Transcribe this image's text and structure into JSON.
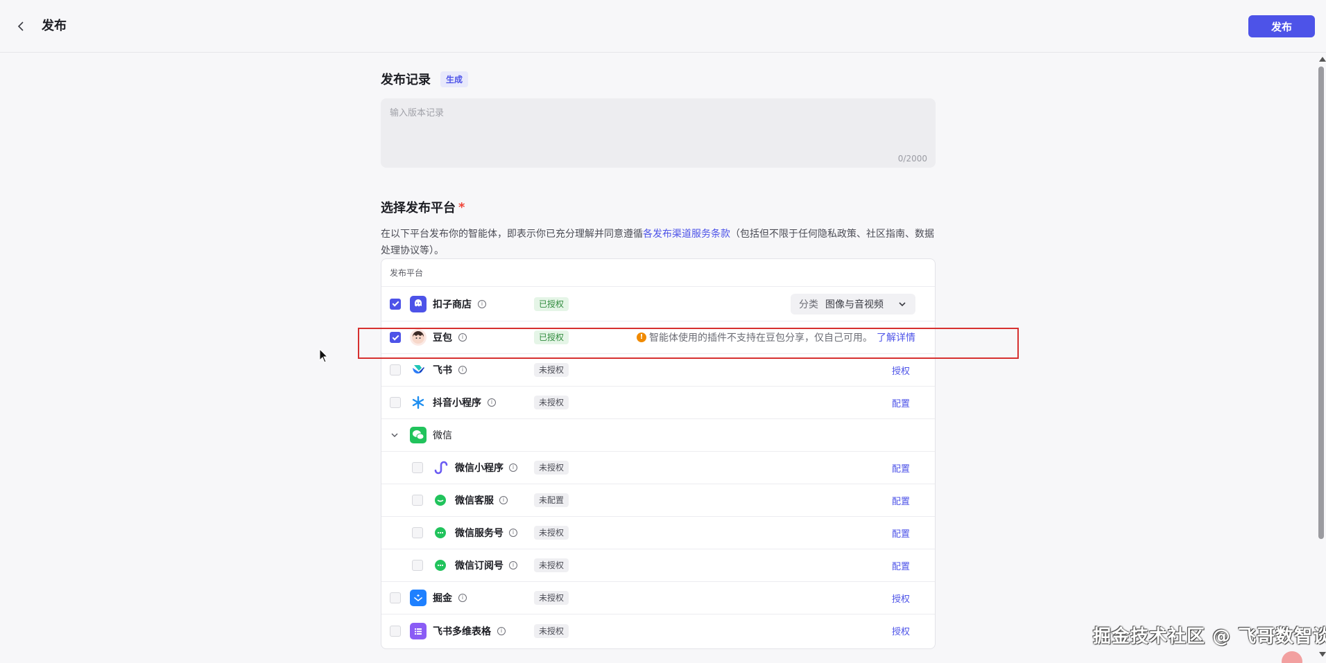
{
  "header": {
    "title": "发布",
    "publish_label": "发布"
  },
  "record": {
    "title": "发布记录",
    "badge": "生成",
    "placeholder": "输入版本记录",
    "counter": "0/2000"
  },
  "platform_section": {
    "title": "选择发布平台",
    "required_mark": "*",
    "desc_prefix": "在以下平台发布你的智能体，即表示你已充分理解并同意遵循",
    "desc_link": "各发布渠道服务条款",
    "desc_suffix": "（包括但不限于任何隐私政策、社区指南、数据处理协议等）。",
    "table_header": "发布平台"
  },
  "platforms": [
    {
      "name": "扣子商店",
      "status": "已授权",
      "category_label": "分类",
      "category_value": "图像与音视频"
    },
    {
      "name": "豆包",
      "status": "已授权",
      "warning": "智能体使用的插件不支持在豆包分享，仅自己可用。",
      "warning_link": "了解详情"
    },
    {
      "name": "飞书",
      "status": "未授权",
      "action": "授权"
    },
    {
      "name": "抖音小程序",
      "status": "未授权",
      "action": "配置"
    },
    {
      "name": "微信"
    },
    {
      "name": "微信小程序",
      "status": "未授权",
      "action": "配置"
    },
    {
      "name": "微信客服",
      "status": "未配置",
      "action": "配置"
    },
    {
      "name": "微信服务号",
      "status": "未授权",
      "action": "配置"
    },
    {
      "name": "微信订阅号",
      "status": "未授权",
      "action": "配置"
    },
    {
      "name": "掘金",
      "status": "未授权",
      "action": "授权"
    },
    {
      "name": "飞书多维表格",
      "status": "未授权",
      "action": "授权"
    }
  ],
  "watermark": "掘金技术社区 @ 飞哥数智谈",
  "colors": {
    "accent": "#4d53e8",
    "highlight": "#d6302f",
    "authorized": "#2f8a3c",
    "warning": "#f08a00"
  }
}
